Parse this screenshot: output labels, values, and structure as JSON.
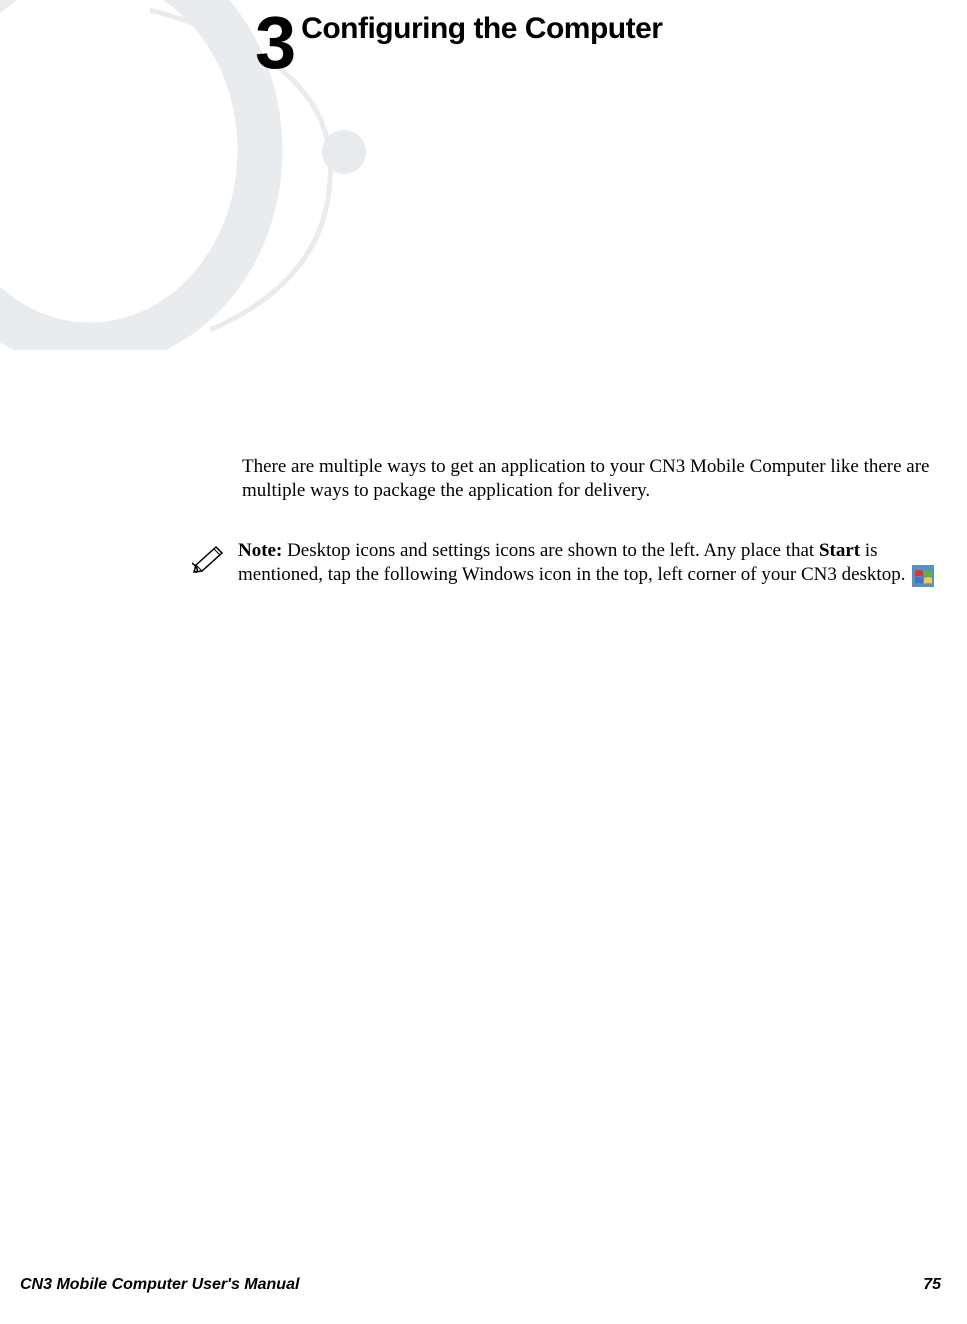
{
  "chapter": {
    "number": "3",
    "title": "Configuring the Computer"
  },
  "body": {
    "intro": "There are multiple ways to get an application to your CN3 Mobile Computer like there are multiple ways to package the application for delivery."
  },
  "note": {
    "label": "Note:",
    "text_before_bold": " Desktop icons and settings icons are shown to the left. Any place that ",
    "bold_word": "Start",
    "text_after_bold": " is mentioned, tap the following Windows icon in the top, left corner of your CN3 desktop."
  },
  "footer": {
    "manual_title": "CN3 Mobile Computer User's Manual",
    "page_number": "75"
  }
}
